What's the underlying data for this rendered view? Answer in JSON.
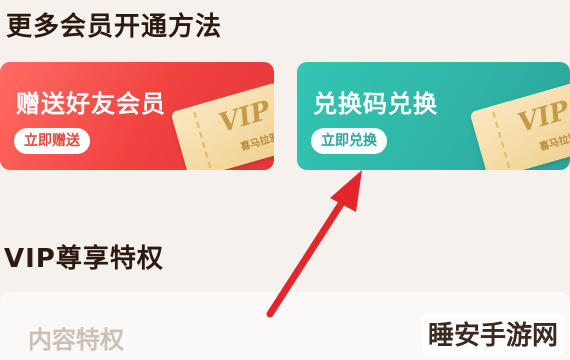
{
  "sections": {
    "more_methods_title": "更多会员开通方法",
    "vip_privileges_title": "VIP尊享特权"
  },
  "cards": {
    "gift": {
      "title": "赠送好友会员",
      "button": "立即赠送",
      "ticket_logo": "VIP",
      "ticket_text": "喜马拉雅"
    },
    "redeem": {
      "title": "兑换码兑换",
      "button": "立即兑换",
      "ticket_logo": "VIP",
      "ticket_text": "喜马拉雅"
    }
  },
  "content": {
    "label": "内容特权"
  },
  "watermark": "睡安手游网",
  "colors": {
    "gift_card": "#f0423f",
    "redeem_card": "#2fb5a6",
    "arrow": "#e2262b"
  }
}
